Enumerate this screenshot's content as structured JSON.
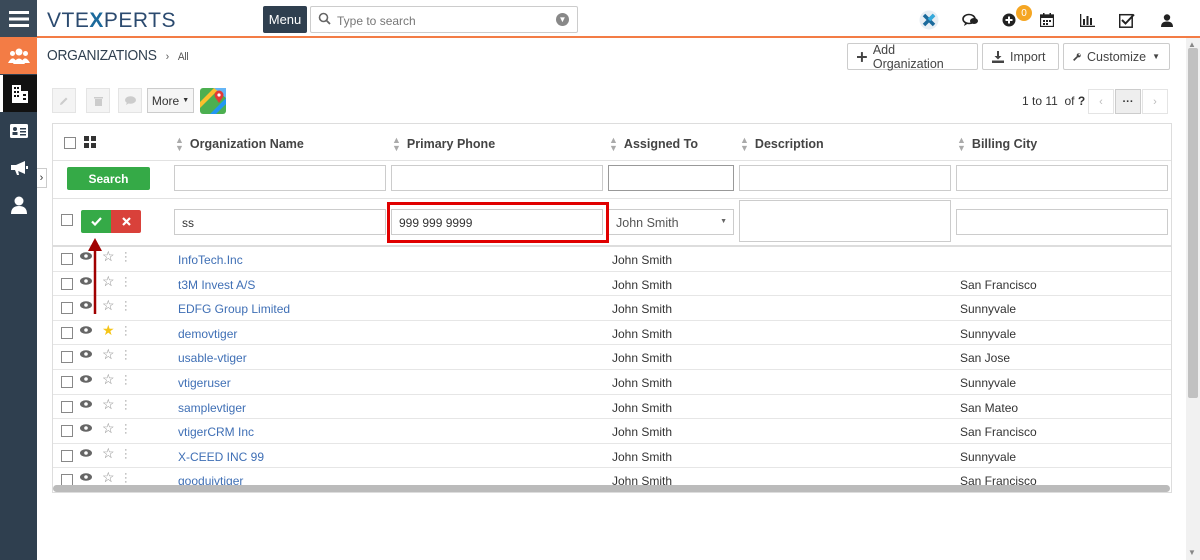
{
  "brand": {
    "logo_left": "VTE",
    "logo_x": "X",
    "logo_right": "PERTS",
    "accent": "#f37c45",
    "nav_dark": "#2f3f4f"
  },
  "topbar": {
    "menu_label": "Menu",
    "search_placeholder": "Type to search",
    "notification_count": "0",
    "icons": [
      "vtexperts-x-icon",
      "chat-icon",
      "plus-circle-icon",
      "calendar-icon",
      "bar-chart-icon",
      "task-checkbox-icon",
      "user-icon"
    ]
  },
  "sidebar": {
    "icons": [
      "hamburger-icon",
      "organizations-icon",
      "building-icon",
      "contact-card-icon",
      "megaphone-icon",
      "person-icon"
    ],
    "expand_arrow": "›"
  },
  "header": {
    "module": "ORGANIZATIONS",
    "separator": "›",
    "filter": "All",
    "add_label": "Add Organization",
    "import_label": "Import",
    "customize_label": "Customize"
  },
  "toolbar": {
    "more_label": "More",
    "pager_text": "1 to 11",
    "pager_of": "of",
    "pager_total": "?",
    "pager_more": "···"
  },
  "table": {
    "columns": [
      "Organization Name",
      "Primary Phone",
      "Assigned To",
      "Description",
      "Billing City"
    ],
    "search_label": "Search",
    "edit_row": {
      "name": "ss",
      "phone": "999 999 9999",
      "assigned": "John Smith",
      "description": "",
      "city": ""
    },
    "rows": [
      {
        "name": "InfoTech.Inc",
        "assigned": "John Smith",
        "city": "",
        "starred": false
      },
      {
        "name": "t3M Invest A/S",
        "assigned": "John Smith",
        "city": "San Francisco",
        "starred": false
      },
      {
        "name": "EDFG Group Limited",
        "assigned": "John Smith",
        "city": "Sunnyvale",
        "starred": false
      },
      {
        "name": "demovtiger",
        "assigned": "John Smith",
        "city": "Sunnyvale",
        "starred": true
      },
      {
        "name": "usable-vtiger",
        "assigned": "John Smith",
        "city": "San Jose",
        "starred": false
      },
      {
        "name": "vtigeruser",
        "assigned": "John Smith",
        "city": "Sunnyvale",
        "starred": false
      },
      {
        "name": "samplevtiger",
        "assigned": "John Smith",
        "city": "San Mateo",
        "starred": false
      },
      {
        "name": "vtigerCRM Inc",
        "assigned": "John Smith",
        "city": "San Francisco",
        "starred": false
      },
      {
        "name": "X-CEED INC 99",
        "assigned": "John Smith",
        "city": "Sunnyvale",
        "starred": false
      },
      {
        "name": "gooduivtiger",
        "assigned": "John Smith",
        "city": "San Francisco",
        "starred": false
      }
    ]
  },
  "annotation": {
    "highlight_color": "#e00000",
    "arrow_color": "#a00000"
  }
}
